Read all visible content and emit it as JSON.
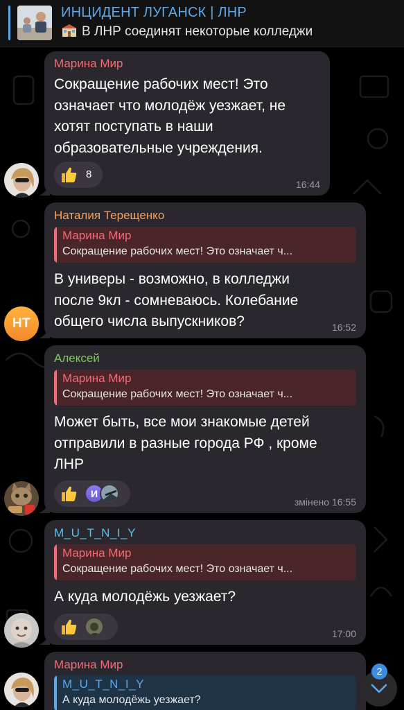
{
  "pinned": {
    "title": "ИНЦИДЕНТ ЛУГАНСК | ЛНР",
    "text": "В ЛНР соединят некоторые  колледжи",
    "emoji_icon": "school-building-icon"
  },
  "messages": [
    {
      "sender": "Марина Мир",
      "lines": [
        "Сокращение рабочих мест! Это",
        "означает что молодёж уезжает, не",
        "хотят поступать в наши",
        "образовательные учреждения."
      ],
      "reaction_count": "8",
      "time": "16:44"
    },
    {
      "sender": "Наталия Терещенко",
      "reply_name": "Марина Мир",
      "reply_text": "Сокращение рабочих мест! Это означает ч...",
      "lines": [
        "В универы - возможно, в колледжи",
        "после 9кл - сомневаюсь. Колебание",
        "общего числа выпускников?"
      ],
      "time": "16:52",
      "avatar_initials": "НТ"
    },
    {
      "sender": "Алексей",
      "reply_name": "Марина Мир",
      "reply_text": "Сокращение рабочих мест! Это означает ч...",
      "lines": [
        "Может быть, все мои знакомые детей",
        "отправили в разные города РФ , кроме",
        "ЛНР"
      ],
      "reaction_avatar_initial": "И",
      "time": "змінено 16:55"
    },
    {
      "sender": "M_U_T_N_I_Y",
      "reply_name": "Марина Мир",
      "reply_text": "Сокращение рабочих мест! Это означает ч...",
      "lines": [
        "А куда молодёжь уезжает?"
      ],
      "time": "17:00"
    },
    {
      "sender": "Марина Мир",
      "reply_name": "M_U_T_N_I_Y",
      "reply_text": "А куда молодёжь уезжает?"
    }
  ],
  "scroll": {
    "unread": "2"
  },
  "colors": {
    "accent": "#5ea8e8",
    "bubble": "#2b272e",
    "marina": "#f06d77",
    "natalia": "#f5a05a",
    "aleksey": "#7fcb5c",
    "mutniy": "#5ec0e8"
  }
}
